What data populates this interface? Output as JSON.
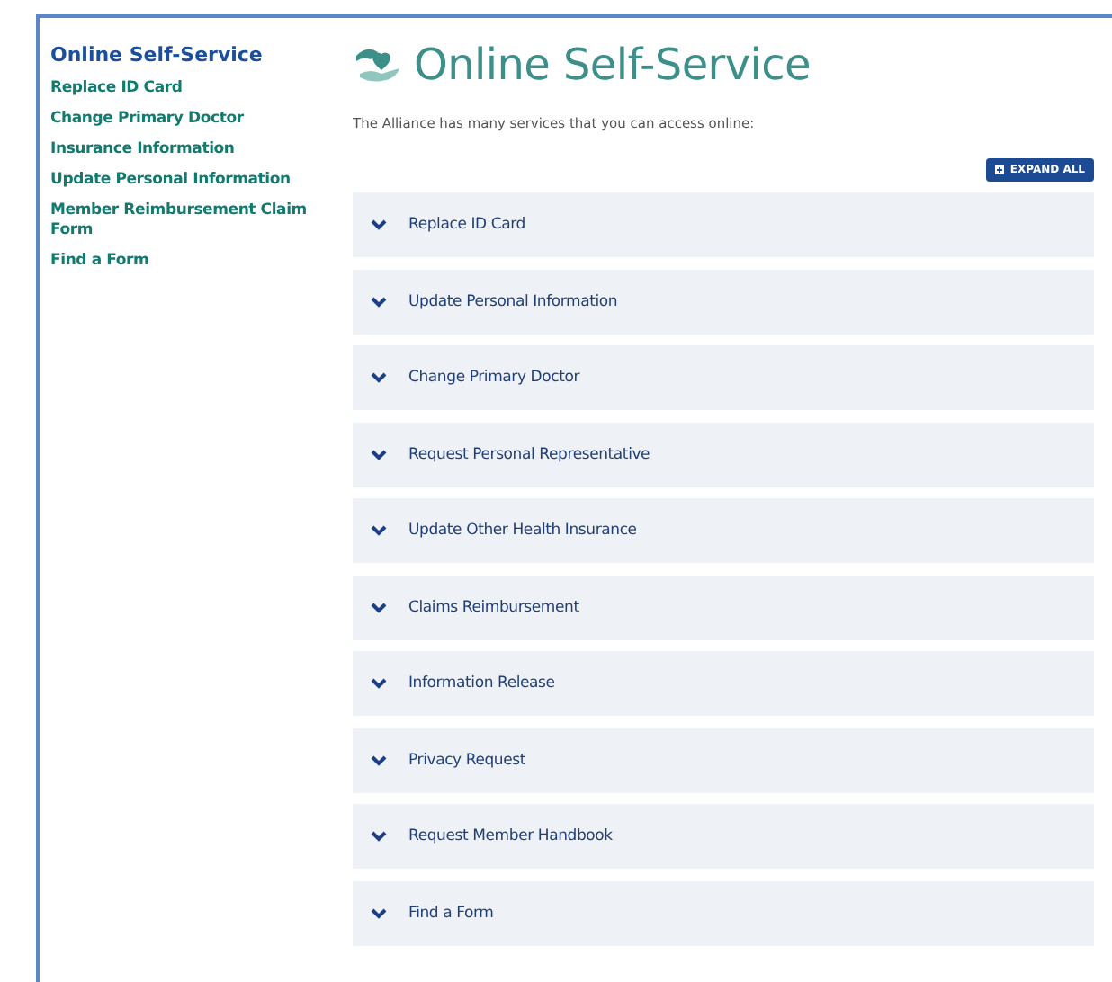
{
  "sidebar": {
    "title": "Online Self-Service",
    "links": [
      "Replace ID Card",
      "Change Primary Doctor",
      "Insurance Information",
      "Update Personal Information",
      "Member Reimbursement Claim Form",
      "Find a Form"
    ]
  },
  "main": {
    "title": "Online Self-Service",
    "intro": "The Alliance has many services that you can access online:",
    "expand_all": "EXPAND ALL",
    "sections": [
      {
        "label": "Replace ID Card",
        "expanded": false
      },
      {
        "label": "Update Personal Information",
        "expanded": false
      },
      {
        "label": "Change Primary Doctor",
        "expanded": false
      },
      {
        "label": "Request Personal Representative",
        "expanded": false
      },
      {
        "label": "Update Other Health Insurance",
        "expanded": false
      },
      {
        "label": "Claims Reimbursement",
        "expanded": false
      },
      {
        "label": "Information Release",
        "expanded": false
      },
      {
        "label": "Privacy Request",
        "expanded": false
      },
      {
        "label": "Request Member Handbook",
        "expanded": false
      },
      {
        "label": "Find a Form",
        "expanded": false
      }
    ]
  }
}
